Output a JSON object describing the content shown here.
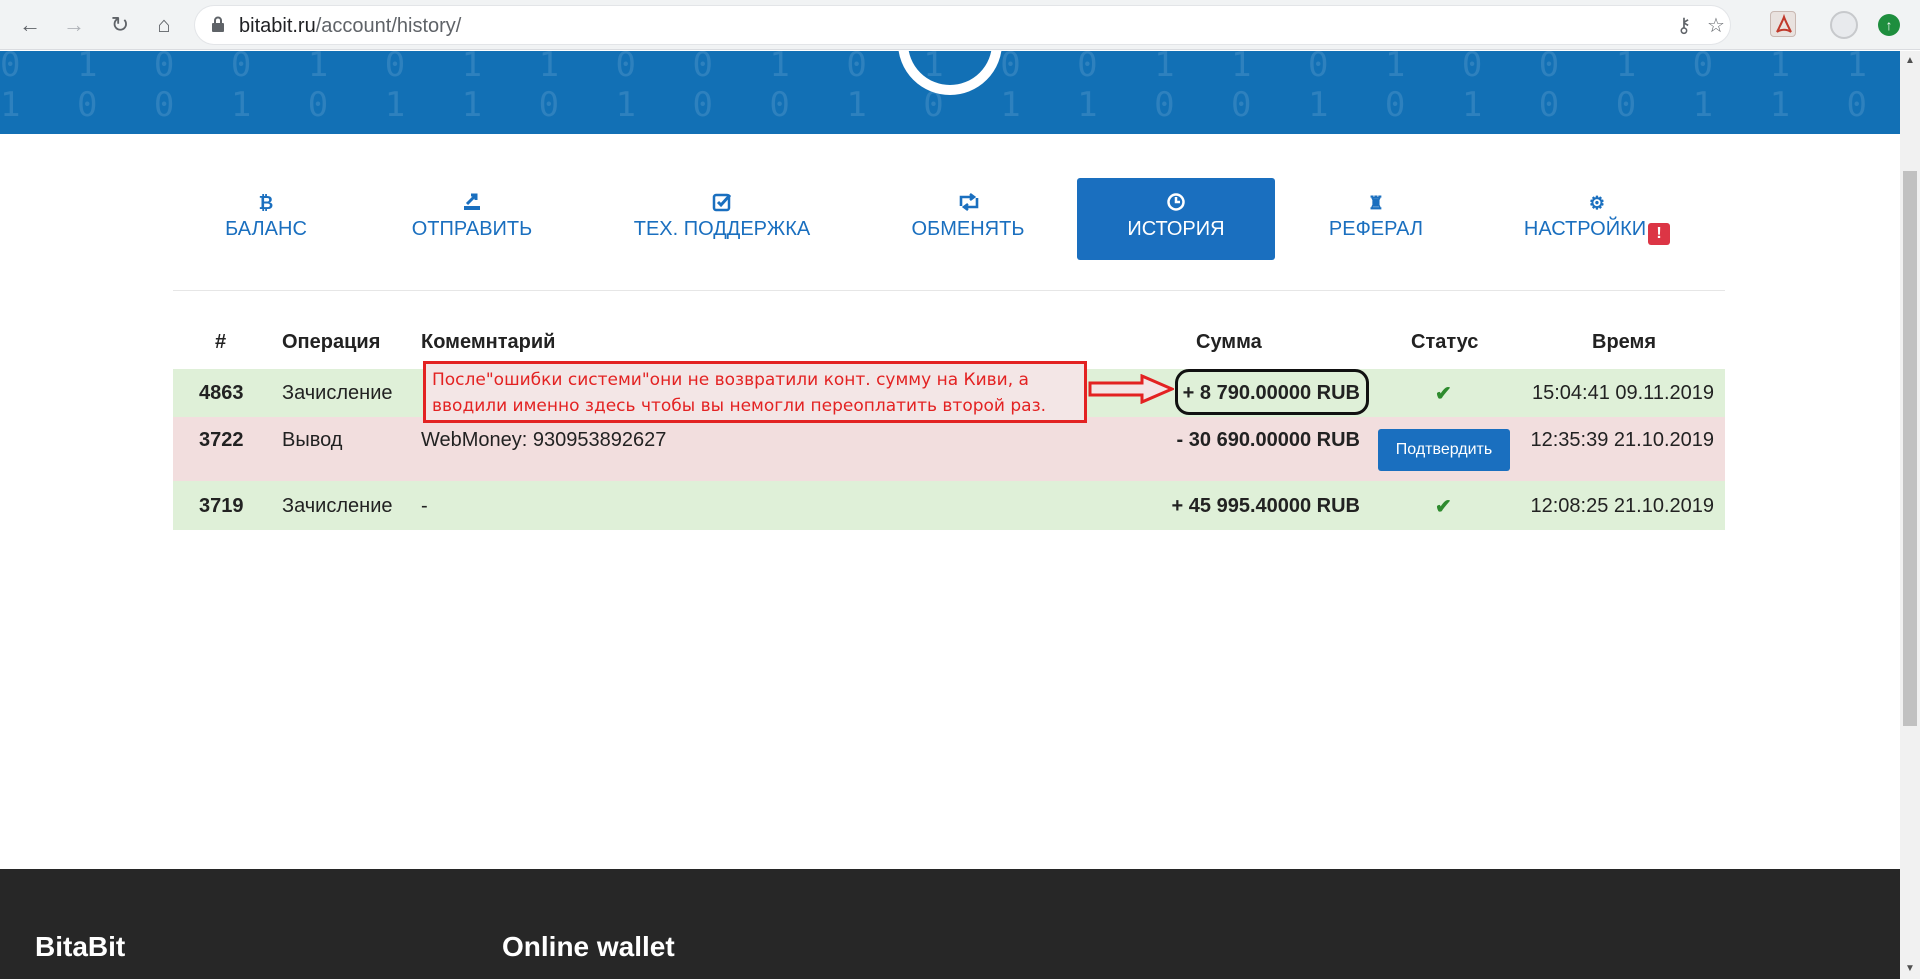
{
  "browser": {
    "url_host": "bitabit.ru",
    "url_path": "/account/history/"
  },
  "tabs": [
    {
      "label": "БАЛАНС",
      "icon": "bitcoin-icon"
    },
    {
      "label": "ОТПРАВИТЬ",
      "icon": "send-icon"
    },
    {
      "label": "ТЕХ. ПОДДЕРЖКА",
      "icon": "check-square-icon"
    },
    {
      "label": "ОБМЕНЯТЬ",
      "icon": "retweet-icon"
    },
    {
      "label": "ИСТОРИЯ",
      "icon": "clock-icon",
      "active": true
    },
    {
      "label": "РЕФЕРАЛ",
      "icon": "chess-rook-icon"
    },
    {
      "label": "НАСТРОЙКИ",
      "icon": "gear-icon",
      "badge": "!"
    }
  ],
  "table": {
    "headers": {
      "num": "#",
      "operation": "Операция",
      "comment": "Комемнтарий",
      "amount": "Сумма",
      "status": "Статус",
      "time": "Время"
    },
    "rows": [
      {
        "num": "4863",
        "operation": "Зачисление",
        "comment": "",
        "amount": "+ 8 790.00000 RUB",
        "status": "done",
        "time": "15:04:41 09.11.2019"
      },
      {
        "num": "3722",
        "operation": "Вывод",
        "comment": "WebMoney: 930953892627",
        "amount": "- 30 690.00000 RUB",
        "status": "pending",
        "status_button": "Подтвердить",
        "time": "12:35:39 21.10.2019"
      },
      {
        "num": "3719",
        "operation": "Зачисление",
        "comment": "-",
        "amount": "+ 45 995.40000 RUB",
        "status": "done",
        "time": "12:08:25 21.10.2019"
      }
    ]
  },
  "annotation": {
    "line1": "После\"ошибки системи\"они не возвратили конт. сумму на Киви, а",
    "line2": "вводили именно здесь чтобы вы немогли переоплатить второй раз.",
    "color": "#e32222"
  },
  "footer": {
    "brand": "BitaBit",
    "col2": "Online wallet"
  },
  "colors": {
    "accent": "#1a6fbf",
    "credit_row": "#dff0d8",
    "debit_row": "#f2dede",
    "footer": "#272727"
  }
}
